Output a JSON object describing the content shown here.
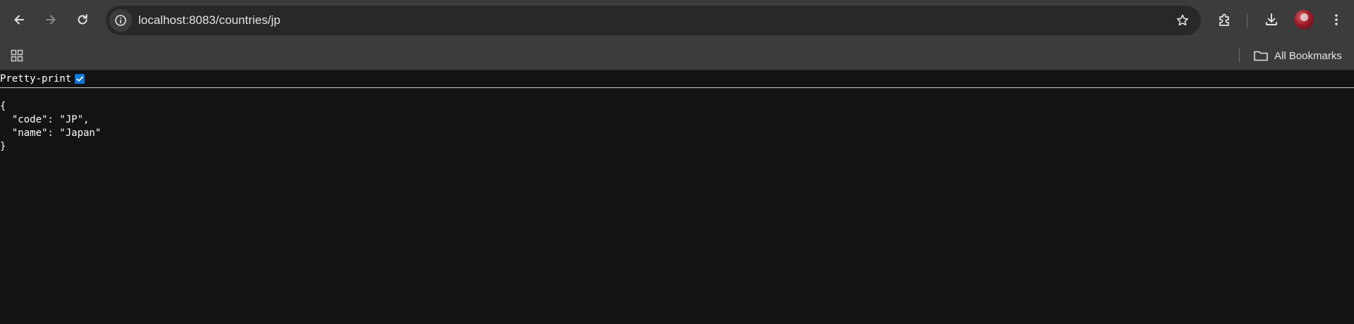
{
  "browser": {
    "url": "localhost:8083/countries/jp",
    "bookmarks_label": "All Bookmarks"
  },
  "page": {
    "pretty_print_label": "Pretty-print",
    "pretty_print_checked": true,
    "json_lines": [
      "{",
      "  \"code\": \"JP\",",
      "  \"name\": \"Japan\"",
      "}"
    ]
  },
  "icons": [
    "back-arrow-icon",
    "forward-arrow-icon",
    "reload-icon",
    "site-info-icon",
    "bookmark-star-icon",
    "extensions-icon",
    "download-icon",
    "avatar",
    "menu-kebab-icon",
    "apps-grid-icon",
    "folder-icon",
    "checkbox-checked-icon"
  ],
  "colors": {
    "toolbar_bg": "#3c3c3c",
    "omnibox_bg": "#282828",
    "content_bg": "#131313",
    "checkbox_accent": "#0b78d7",
    "text": "#e3e3e3"
  }
}
